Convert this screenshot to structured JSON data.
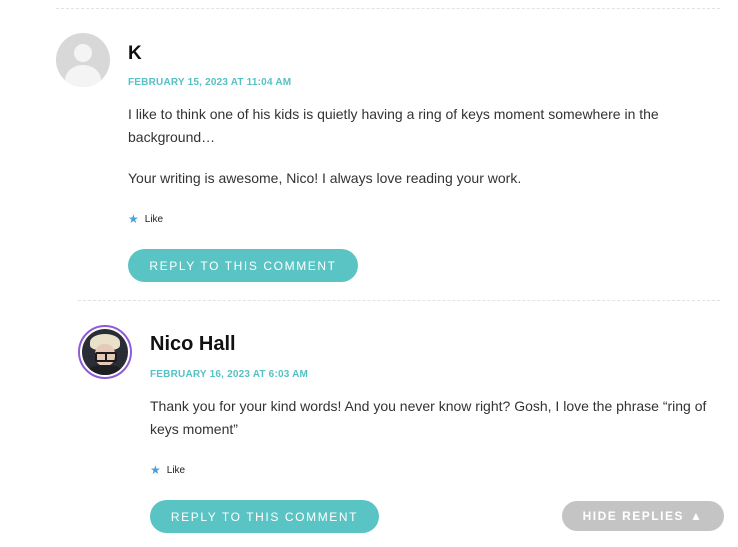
{
  "comments": [
    {
      "author": "K",
      "date": "FEBRUARY 15, 2023 AT 11:04 AM",
      "paragraphs": [
        "I like to think one of his kids is quietly having a ring of keys moment somewhere in the background…",
        "Your writing is awesome, Nico! I always love reading your work."
      ],
      "like_label": "Like",
      "reply_label": "REPLY TO THIS COMMENT"
    },
    {
      "author": "Nico Hall",
      "date": "FEBRUARY 16, 2023 AT 6:03 AM",
      "paragraphs": [
        "Thank you for your kind words! And you never know right? Gosh, I love the phrase “ring of keys moment”"
      ],
      "like_label": "Like",
      "reply_label": "REPLY TO THIS COMMENT"
    }
  ],
  "hide_replies_label": "HIDE REPLIES",
  "icons": {
    "like": "star-icon",
    "hide_replies": "triangle-up-icon"
  },
  "colors": {
    "accent": "#5ac4c4",
    "date": "#55c1c4",
    "like_star": "#4a9fd8",
    "avatar_ring": "#8e5ad6",
    "hide_button": "#c4c4c4"
  }
}
